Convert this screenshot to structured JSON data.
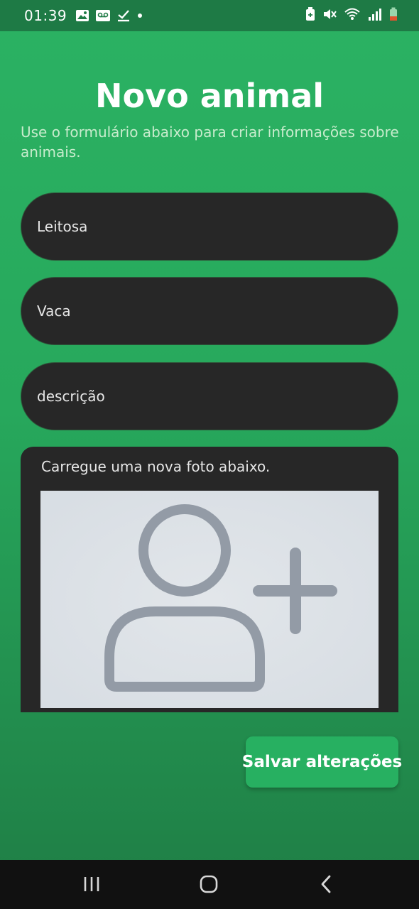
{
  "status_bar": {
    "time": "01:39",
    "left_icons": [
      "image-icon",
      "voicemail-icon",
      "check-icon",
      "dot-icon"
    ],
    "right_icons": [
      "battery-saver-icon",
      "mute-icon",
      "wifi-icon",
      "signal-icon",
      "battery-icon"
    ]
  },
  "page": {
    "title": "Novo animal",
    "subtitle": "Use o formulário abaixo para criar informações sobre animais."
  },
  "form": {
    "name_value": "Leitosa",
    "species_value": "Vaca",
    "description_placeholder": "descrição",
    "photo_label": "Carregue uma nova foto abaixo.",
    "photo_icon": "add-user-icon",
    "save_label": "Salvar alterações"
  },
  "colors": {
    "background": "#27a85c",
    "field_bg": "#272727",
    "button_bg": "#27b061",
    "nav_bg": "#111111"
  },
  "nav": {
    "items": [
      "recent-apps-icon",
      "home-icon",
      "back-icon"
    ]
  }
}
